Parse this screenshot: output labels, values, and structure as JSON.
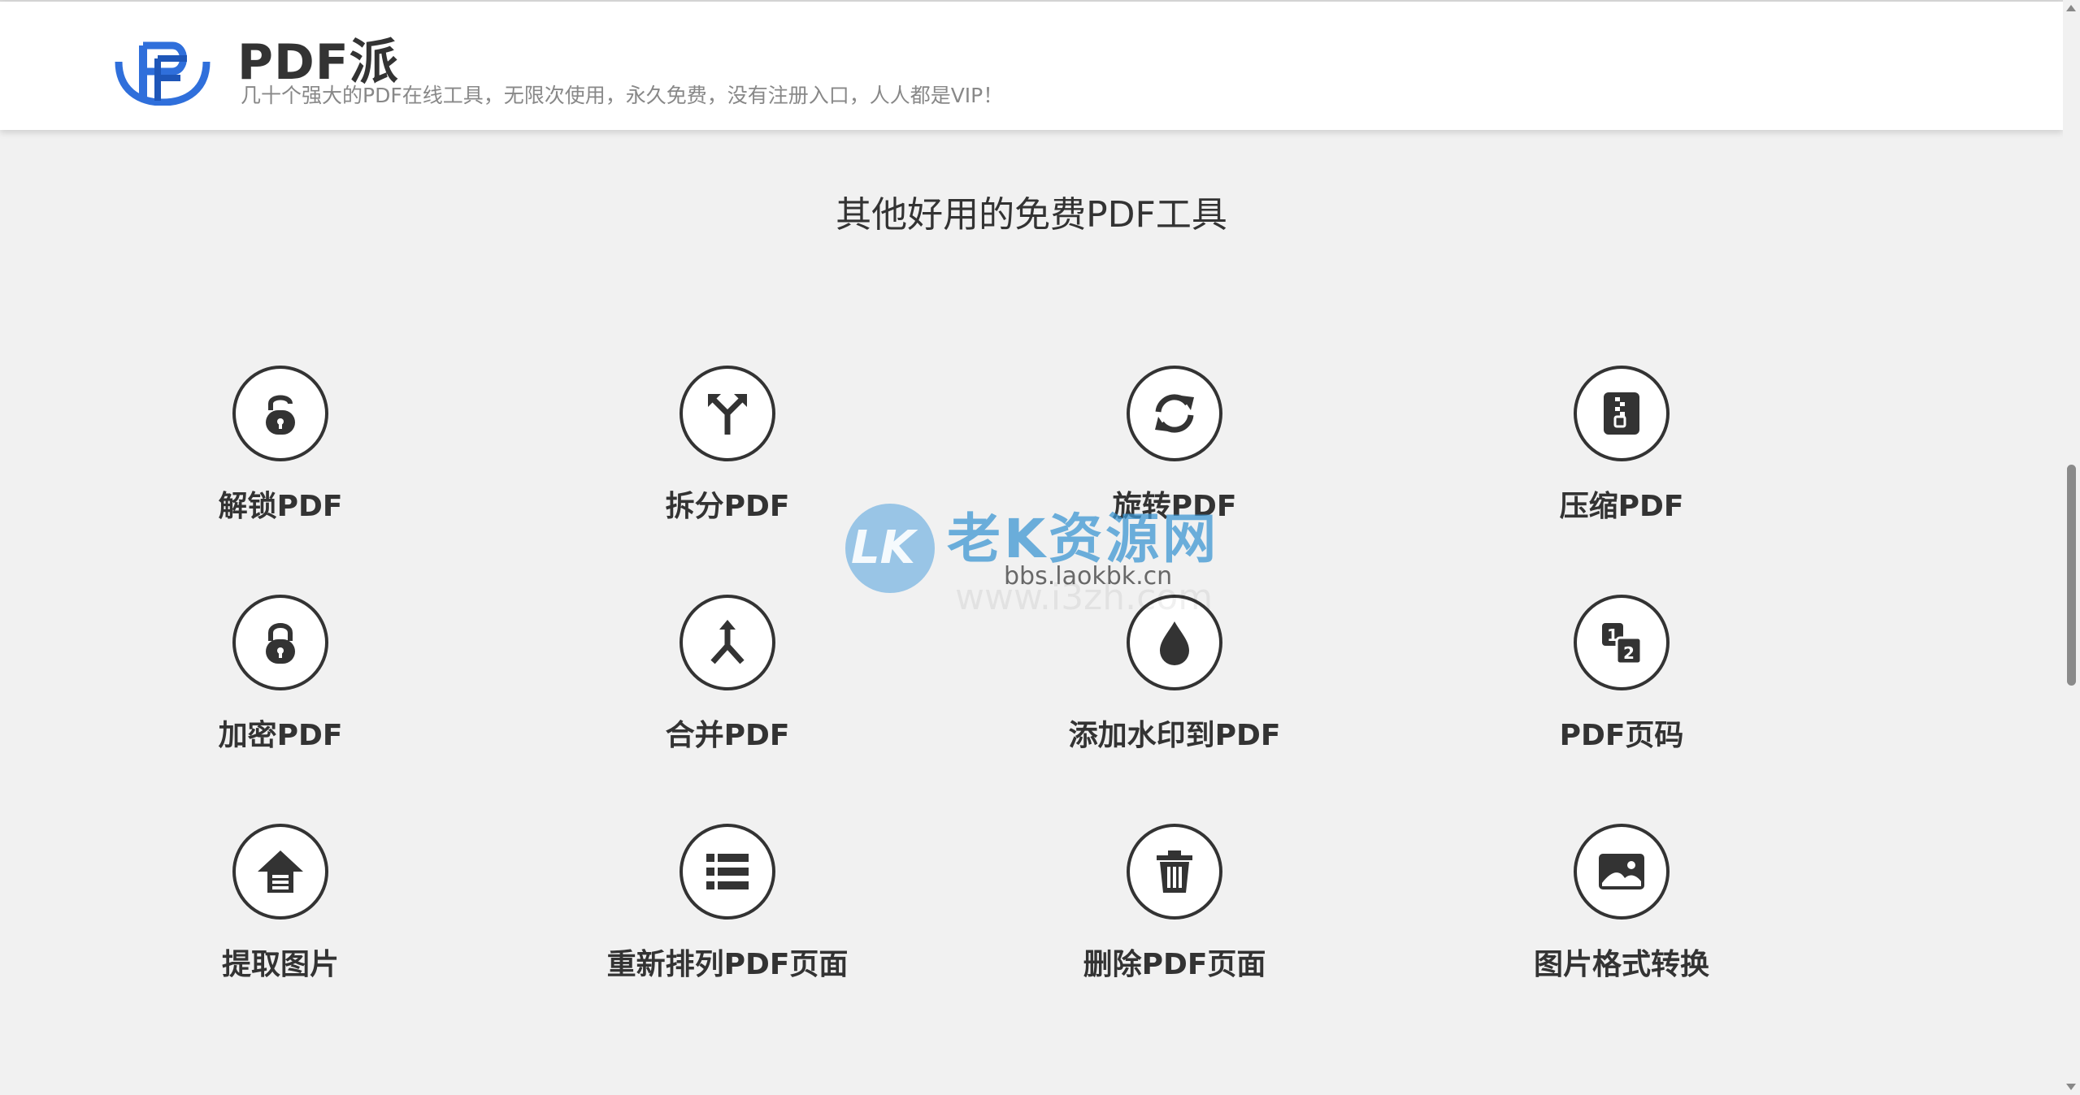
{
  "header": {
    "brand_name": "PDF派",
    "tagline": "几十个强大的PDF在线工具，无限次使用，永久免费，没有注册入口，人人都是VIP！",
    "logo_icon": "pf-logo-icon",
    "brand_color": "#2f6fdb"
  },
  "section": {
    "title": "其他好用的免费PDF工具"
  },
  "tools": [
    {
      "label": "解锁PDF",
      "icon": "unlock-icon"
    },
    {
      "label": "拆分PDF",
      "icon": "split-arrows-icon"
    },
    {
      "label": "旋转PDF",
      "icon": "rotate-icon"
    },
    {
      "label": "压缩PDF",
      "icon": "zip-icon"
    },
    {
      "label": "加密PDF",
      "icon": "lock-icon"
    },
    {
      "label": "合并PDF",
      "icon": "merge-arrows-icon"
    },
    {
      "label": "添加水印到PDF",
      "icon": "drop-icon"
    },
    {
      "label": "PDF页码",
      "icon": "page-number-icon"
    },
    {
      "label": "提取图片",
      "icon": "extract-icon"
    },
    {
      "label": "重新排列PDF页面",
      "icon": "list-icon"
    },
    {
      "label": "删除PDF页面",
      "icon": "trash-icon"
    },
    {
      "label": "图片格式转换",
      "icon": "image-icon"
    }
  ],
  "watermark": {
    "logo": "LK",
    "text": "老K资源网",
    "url": "bbs.laokbk.cn",
    "ghost_url": "www.i3zh.com"
  },
  "colors": {
    "background": "#f1f1f1",
    "icon_dark": "#333333",
    "header_bg": "#ffffff"
  }
}
